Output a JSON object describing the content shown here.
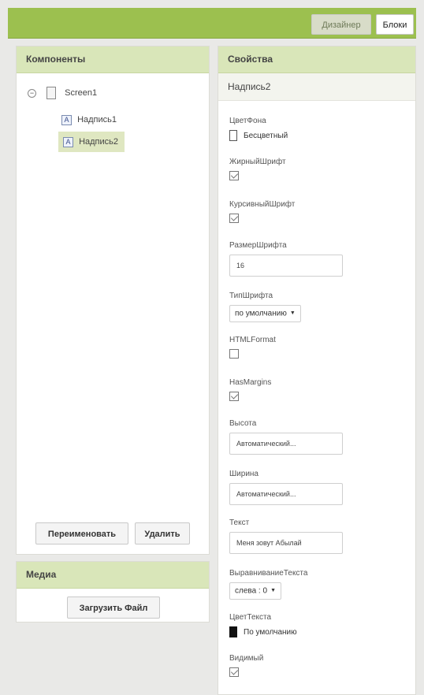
{
  "topbar": {
    "designer_label": "Дизайнер",
    "blocks_label": "Блоки"
  },
  "components": {
    "title": "Компоненты",
    "tree": {
      "root": "Screen1",
      "children": [
        "Надпись1",
        "Надпись2"
      ],
      "selected": "Надпись2"
    },
    "rename_label": "Переименовать",
    "delete_label": "Удалить"
  },
  "media": {
    "title": "Медиа",
    "upload_label": "Загрузить Файл"
  },
  "properties": {
    "title": "Свойства",
    "component_name": "Надпись2",
    "background_color": {
      "label": "ЦветФона",
      "value": "Бесцветный",
      "swatch": "#ffffff"
    },
    "font_bold": {
      "label": "ЖирныйШрифт",
      "checked": true
    },
    "font_italic": {
      "label": "КурсивныйШрифт",
      "checked": true
    },
    "font_size": {
      "label": "РазмерШрифта",
      "value": "16"
    },
    "font_typeface": {
      "label": "ТипШрифта",
      "value": "по умолчанию"
    },
    "html_format": {
      "label": "HTMLFormat",
      "checked": false
    },
    "has_margins": {
      "label": "HasMargins",
      "checked": true
    },
    "height": {
      "label": "Высота",
      "value": "Автоматический..."
    },
    "width": {
      "label": "Ширина",
      "value": "Автоматический..."
    },
    "text": {
      "label": "Текст",
      "value": "Меня зовут Абылай"
    },
    "text_alignment": {
      "label": "ВыравниваниеТекста",
      "value": "слева : 0"
    },
    "text_color": {
      "label": "ЦветТекста",
      "value": "По умолчанию",
      "swatch": "#111111"
    },
    "visible": {
      "label": "Видимый",
      "checked": true
    }
  },
  "colors": {
    "topbar": "#9cc04f",
    "panel_header": "#d9e6b9",
    "selected_row": "#dfe7c1"
  }
}
